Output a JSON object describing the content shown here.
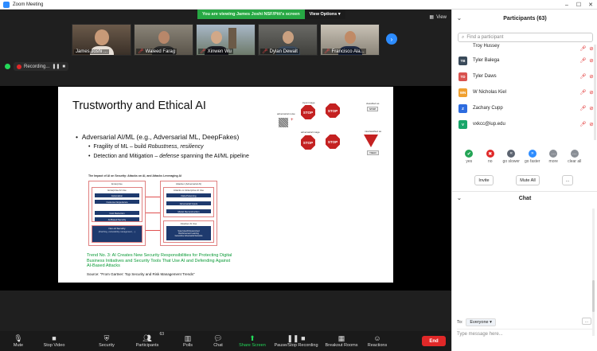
{
  "window": {
    "title": "Zoom Meeting"
  },
  "banner": {
    "message": "You are viewing James Joshi NSF/Pitt's screen",
    "options_label": "View Options",
    "options_caret": "▾"
  },
  "view_button": {
    "label": "View"
  },
  "gallery": [
    {
      "name": "James Joshi ...",
      "muted": false
    },
    {
      "name": "Waleed Farag",
      "muted": true
    },
    {
      "name": "Xinwen Wu",
      "muted": true
    },
    {
      "name": "Dylan Dewalt",
      "muted": true
    },
    {
      "name": "Francisco Ala...",
      "muted": true
    }
  ],
  "recording": {
    "label": "Recording...",
    "pause": "❚❚",
    "stop": "■"
  },
  "slide": {
    "title": "Trustworthy and Ethical AI",
    "bullet": "Adversarial AI/ML (e.g., Adversarial ML, DeepFakes)",
    "sub1_prefix": "Fragility of ML – build ",
    "sub1_em": "Robustness, resiliency",
    "sub2_prefix": "Detection and Mitigation – ",
    "sub2_em": "defense",
    "sub2_suffix": " spanning the AI/ML pipeline",
    "figure_title": "The Impact of AI on Security: Attacks on AI, and Attacks Leveraging AI",
    "figure": {
      "enterprise": "Enterprise",
      "attacker": "Attacker (Adversarial AI)",
      "enterprise_ai_use": "Enterprise AI Use",
      "attacks_on_ai": "Attacks on Enterprise AI Use",
      "left_items": [
        "Automation",
        "Customer Experience",
        "Cost Reduction",
        "AI-Based Security"
      ],
      "right_items": [
        "Data Poisoning",
        "Adversarial Inputs",
        "Model Reconstruction"
      ],
      "attacker_ai_use": "Attacker AI Use",
      "attacker_items": [
        "Supervised/Unsupervised",
        "Reinforcement Learning",
        "Generative Adversarial Networks"
      ],
      "nonai_security": "Non-AI Security",
      "nonai_text": "(Patching, vulnerability management, ...)"
    },
    "trend": "Trend No. 3: AI Creates New Security Responsibilities for Protecting Digital Business Initiatives and Security Tools That Use AI and Defending Against AI-Based Attacks",
    "source": "Source: \"From Gartner: Top Security and Risk Management Trends\"",
    "adv": {
      "input_image": "input image",
      "classified_as": "classified as",
      "adversarial_noise": "adversarial noise",
      "adversarial_image": "adversarial image",
      "misclassified_as": "misclassified as",
      "stop_text": "STOP",
      "pred_top": "STOP",
      "pred_bottom": "YIELD"
    }
  },
  "toolbar": {
    "mute": "Mute",
    "stop_video": "Stop Video",
    "security": "Security",
    "participants": "Participants",
    "participants_count": "63",
    "polls": "Polls",
    "chat": "Chat",
    "share_screen": "Share Screen",
    "pause_recording": "Pause/Stop Recording",
    "breakout_rooms": "Breakout Rooms",
    "reactions": "Reactions",
    "end": "End"
  },
  "participants": {
    "title": "Participants (63)",
    "search_placeholder": "Find a participant",
    "list": [
      {
        "initials": "",
        "name": "Troy Hussey",
        "color": "#7a8a99"
      },
      {
        "initials": "TB",
        "name": "Tyler Balega",
        "color": "#3a4a5a"
      },
      {
        "initials": "TD",
        "name": "Tyler Daws",
        "color": "#d9534f"
      },
      {
        "initials": "WN",
        "name": "W Nicholas Kiel",
        "color": "#f0a030"
      },
      {
        "initials": "Z",
        "name": "Zachary Cupp",
        "color": "#2d6cdf"
      },
      {
        "initials": "V",
        "name": "vxkcc@iup.edu",
        "color": "#18a66a"
      }
    ],
    "reactions": [
      {
        "label": "yes",
        "symbol": "✔",
        "color": "#23a455"
      },
      {
        "label": "no",
        "symbol": "✖",
        "color": "#e02828"
      },
      {
        "label": "go slower",
        "symbol": "«",
        "color": "#5c6470"
      },
      {
        "label": "go faster",
        "symbol": "»",
        "color": "#2d8cff"
      },
      {
        "label": "more",
        "symbol": "…",
        "color": "#8a8f96"
      },
      {
        "label": "clear all",
        "symbol": "…",
        "color": "#8a8f96"
      }
    ],
    "invite": "Invite",
    "mute_all": "Mute All",
    "more": "..."
  },
  "chat": {
    "title": "Chat",
    "to_label": "To:",
    "to_value": "Everyone",
    "more": "...",
    "input_placeholder": "Type message here..."
  }
}
